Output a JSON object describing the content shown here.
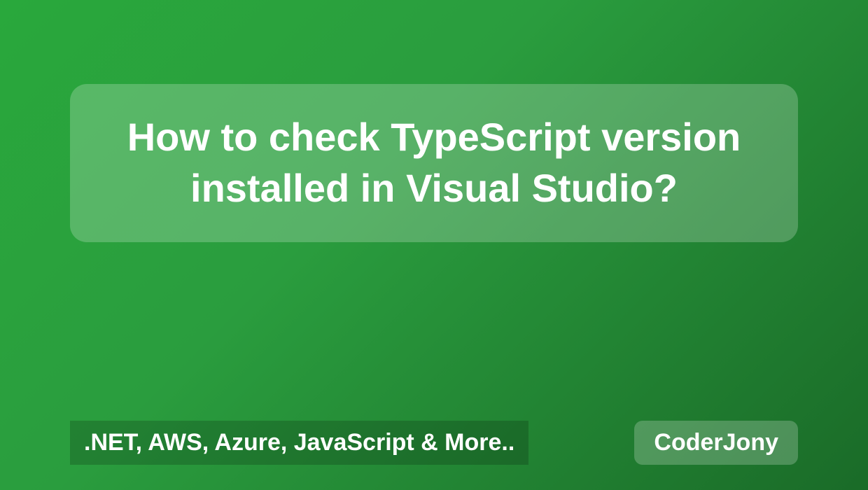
{
  "card": {
    "title": "How to check TypeScript version installed in Visual Studio?"
  },
  "footer": {
    "tagline": ".NET, AWS, Azure, JavaScript & More..",
    "brand": "CoderJony"
  }
}
